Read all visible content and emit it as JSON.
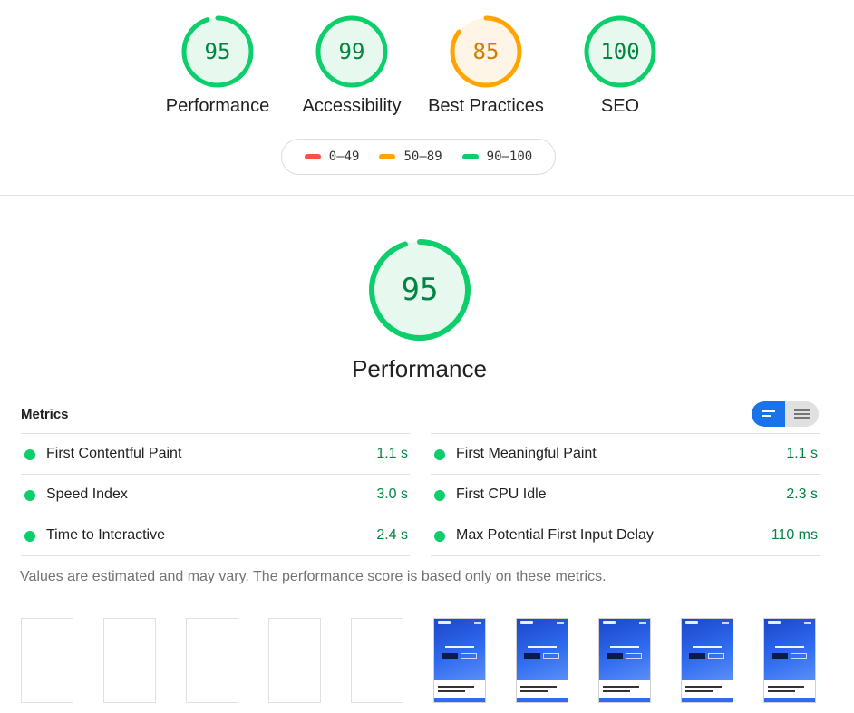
{
  "summary": {
    "categories": [
      {
        "label": "Performance",
        "score": "95",
        "color": "#0cce6b",
        "bg": "#e7f8ef",
        "text_color": "#018642"
      },
      {
        "label": "Accessibility",
        "score": "99",
        "color": "#0cce6b",
        "bg": "#e7f8ef",
        "text_color": "#018642"
      },
      {
        "label": "Best Practices",
        "score": "85",
        "color": "#ffa400",
        "bg": "#fff5e6",
        "text_color": "#d47b00"
      },
      {
        "label": "SEO",
        "score": "100",
        "color": "#0cce6b",
        "bg": "#e7f8ef",
        "text_color": "#018642"
      }
    ],
    "legend": [
      {
        "range": "0–49",
        "color": "#ff4e42"
      },
      {
        "range": "50–89",
        "color": "#ffa400"
      },
      {
        "range": "90–100",
        "color": "#0cce6b"
      }
    ]
  },
  "performance": {
    "score": "95",
    "title": "Performance",
    "metrics_heading": "Metrics",
    "metrics_left": [
      {
        "name": "First Contentful Paint",
        "value": "1.1 s"
      },
      {
        "name": "Speed Index",
        "value": "3.0 s"
      },
      {
        "name": "Time to Interactive",
        "value": "2.4 s"
      }
    ],
    "metrics_right": [
      {
        "name": "First Meaningful Paint",
        "value": "1.1 s"
      },
      {
        "name": "First CPU Idle",
        "value": "2.3 s"
      },
      {
        "name": "Max Potential First Input Delay",
        "value": "110 ms"
      }
    ],
    "note": "Values are estimated and may vary. The performance score is based only on these metrics.",
    "filmstrip": [
      "blank",
      "blank",
      "blank",
      "blank",
      "blank",
      "rendered",
      "rendered",
      "rendered",
      "rendered",
      "rendered"
    ],
    "accent": "#1a73e8"
  }
}
